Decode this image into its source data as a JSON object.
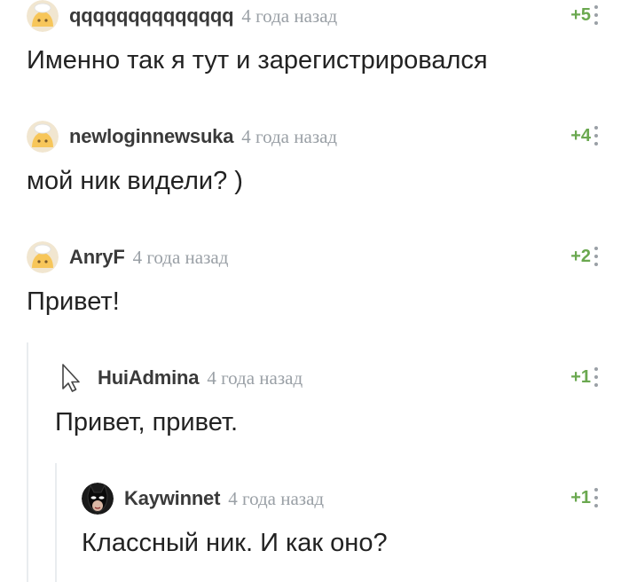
{
  "comments": [
    {
      "author": "qqqqqqqqqqqqqq",
      "time": "4 года назад",
      "rating": "+5",
      "text": "Именно так я тут и зарегистрировался",
      "avatar": "pikabu-default-avatar-icon"
    },
    {
      "author": "newloginnewsuka",
      "time": "4 года назад",
      "rating": "+4",
      "text": "мой ник видели? )",
      "avatar": "pikabu-default-avatar-icon"
    },
    {
      "author": "AnryF",
      "time": "4 года назад",
      "rating": "+2",
      "text": "Привет!",
      "avatar": "pikabu-default-avatar-icon"
    },
    {
      "author": "HuiAdmina",
      "time": "4 года назад",
      "rating": "+1",
      "text": "Привет, привет.",
      "avatar": "mouse-cursor-icon"
    },
    {
      "author": "Kaywinnet",
      "time": "4 года назад",
      "rating": "+1",
      "text": "Классный ник. И как оно?",
      "avatar": "catwoman-avatar-icon"
    }
  ],
  "colors": {
    "rating": "#6aa84f",
    "time": "#9aa0a6",
    "thread_line": "#e9ecef"
  }
}
